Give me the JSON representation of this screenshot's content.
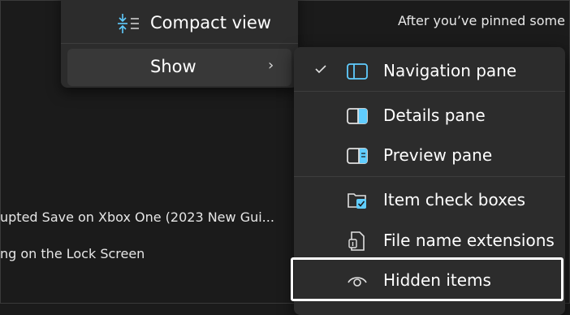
{
  "background": {
    "hint_text": "After you’ve pinned some",
    "list_items": [
      "upted Save on Xbox One (2023 New Gui...",
      "ng on the Lock Screen"
    ]
  },
  "view_menu": {
    "items": [
      {
        "label": "Compact view",
        "icon": "compact-view-icon"
      },
      {
        "label": "Show",
        "icon": "chevron-right-icon",
        "expanded": true
      }
    ]
  },
  "show_submenu": {
    "items": [
      {
        "label": "Navigation pane",
        "icon": "navigation-pane-icon",
        "checked": true
      },
      {
        "label": "Details pane",
        "icon": "details-pane-icon",
        "checked": false
      },
      {
        "label": "Preview pane",
        "icon": "preview-pane-icon",
        "checked": false
      },
      {
        "label": "Item check boxes",
        "icon": "item-check-boxes-icon",
        "checked": false
      },
      {
        "label": "File name extensions",
        "icon": "file-name-extensions-icon",
        "checked": false
      },
      {
        "label": "Hidden items",
        "icon": "hidden-items-icon",
        "checked": false,
        "highlighted": true
      }
    ]
  },
  "colors": {
    "background": "#1b1b1b",
    "menu": "#2c2c2c",
    "hover": "#383838",
    "accent": "#60cdff",
    "text": "#ffffff",
    "highlight_border": "#ffffff"
  }
}
